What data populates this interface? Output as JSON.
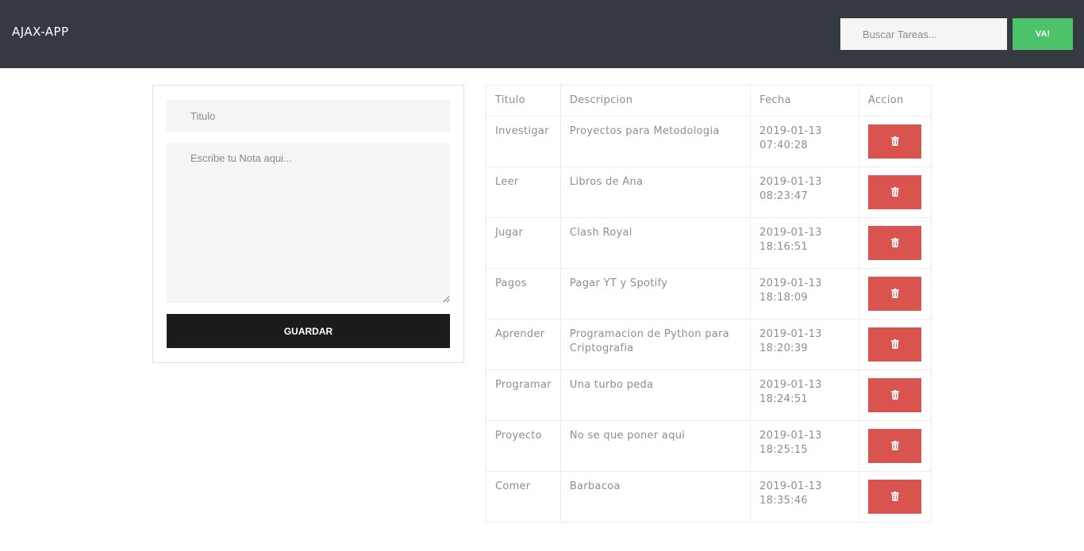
{
  "navbar": {
    "brand": "AJAX-APP",
    "search_placeholder": "Buscar Tareas...",
    "search_button": "VA!"
  },
  "form": {
    "title_placeholder": "Titulo",
    "description_placeholder": "Escribe tu Nota aqui...",
    "save_button": "GUARDAR"
  },
  "table": {
    "headers": [
      "Titulo",
      "Descripcion",
      "Fecha",
      "Accion"
    ],
    "rows": [
      {
        "titulo": "Investigar",
        "descripcion": "Proyectos para Metodologia",
        "fecha_date": "2019-01-13",
        "fecha_time": "07:40:28"
      },
      {
        "titulo": "Leer",
        "descripcion": "Libros de Ana",
        "fecha_date": "2019-01-13",
        "fecha_time": "08:23:47"
      },
      {
        "titulo": "Jugar",
        "descripcion": "Clash Royal",
        "fecha_date": "2019-01-13",
        "fecha_time": "18:16:51"
      },
      {
        "titulo": "Pagos",
        "descripcion": "Pagar YT y Spotify",
        "fecha_date": "2019-01-13",
        "fecha_time": "18:18:09"
      },
      {
        "titulo": "Aprender",
        "descripcion": "Programacion de Python para Criptografia",
        "fecha_date": "2019-01-13",
        "fecha_time": "18:20:39"
      },
      {
        "titulo": "Programar",
        "descripcion": "Una turbo peda",
        "fecha_date": "2019-01-13",
        "fecha_time": "18:24:51"
      },
      {
        "titulo": "Proyecto",
        "descripcion": "No se que poner aqui",
        "fecha_date": "2019-01-13",
        "fecha_time": "18:25:15"
      },
      {
        "titulo": "Comer",
        "descripcion": "Barbacoa",
        "fecha_date": "2019-01-13",
        "fecha_time": "18:35:46"
      }
    ],
    "delete_icon": "trash-icon"
  },
  "colors": {
    "navbar_bg": "#343a40",
    "search_button_bg": "#4cc36b",
    "save_button_bg": "#1b1b1b",
    "delete_button_bg": "#d9534f"
  }
}
